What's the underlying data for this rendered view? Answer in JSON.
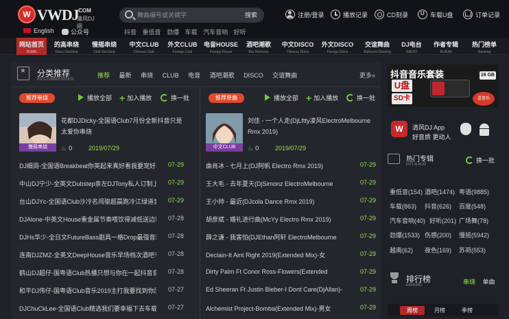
{
  "header": {
    "logo_brand": "VWDJ",
    "logo_com": ".COM",
    "logo_cn": "清风DJ网",
    "search_placeholder": "舞曲编号或关键字",
    "search_button": "搜索",
    "hot_keywords": [
      "抖音",
      "重低音",
      "劲爆",
      "车载",
      "汽车音响",
      "好听"
    ],
    "language": "English",
    "wechat": "公众号",
    "top_links": [
      {
        "label": "注册/登录",
        "icon": "user-icon"
      },
      {
        "label": "播放记录",
        "icon": "clock-icon"
      },
      {
        "label": "CD刻录",
        "icon": "cd-icon"
      },
      {
        "label": "车载U盘",
        "icon": "usb-icon"
      },
      {
        "label": "订单记录",
        "icon": "cart-icon"
      }
    ]
  },
  "nav": [
    {
      "cn": "网站首页",
      "en": "HOME",
      "active": true
    },
    {
      "cn": "的高串烧",
      "en": "Disco NonStop"
    },
    {
      "cn": "慢摇串烧",
      "en": "Club NonStop"
    },
    {
      "cn": "中文CLUB",
      "en": "Chinese Club"
    },
    {
      "cn": "外文CLUB",
      "en": "Foreign Club"
    },
    {
      "cn": "电音HOUSE",
      "en": "Foreign House"
    },
    {
      "cn": "酒吧潮歌",
      "en": "Bar Remixes"
    },
    {
      "cn": "中文DISCO",
      "en": "Chinese Disco"
    },
    {
      "cn": "外文DISCO",
      "en": "Foreign Disco"
    },
    {
      "cn": "交谊舞曲",
      "en": "Ballroom Dancing"
    },
    {
      "cn": "DJ电台",
      "en": "RADIO"
    },
    {
      "cn": "作者专辑",
      "en": "ALBUM"
    },
    {
      "cn": "热门榜单",
      "en": "Ranking"
    }
  ],
  "category": {
    "title": "分类推荐",
    "subtitle": "RECOMMENDED",
    "tabs": [
      "推荐",
      "最新",
      "串烧",
      "CLUB",
      "电音",
      "酒吧潮歌",
      "DISCO",
      "交谊舞曲"
    ],
    "active_tab": 0,
    "more": "更多»"
  },
  "actions": {
    "play_all": "播放全部",
    "add_play": "加入播放",
    "swap": "换一批"
  },
  "left_list": {
    "tag": "推荐串烧",
    "feature": {
      "title": "花都DJDicky-全国语Club7月份全新抖音只是太爱你串烧",
      "badge": "慢摇串烧",
      "plays": "0",
      "date": "2019/07/29"
    },
    "rows": [
      {
        "title": "DJ细周-全国语Breakbeat你英起来真好看我要宠好看",
        "date": "07-29",
        "new": true
      },
      {
        "title": "中山DJ宁少-全英文Dubstep亲左DJTony私人订制上",
        "date": "07-29",
        "new": true
      },
      {
        "title": "台山DJYc-全国语Club沙冷名闯驱超晨跑冷江绿道音乐",
        "date": "07-29",
        "new": true
      },
      {
        "title": "DJAlone-中英文House重金属节奏嗒饮得减低送边场",
        "date": "07-28",
        "new": false
      },
      {
        "title": "DJHs华少-全日文FutureBass剧具一格Drop最强音霸",
        "date": "07-28",
        "new": false
      },
      {
        "title": "连南DJZMZ-全英文DeepHouse音乐早场档次酒吧专",
        "date": "07-28",
        "new": false
      },
      {
        "title": "鹤山DJ超仔-国粤语Club热播只想与你在一起抖音音乐",
        "date": "07-28",
        "new": false
      },
      {
        "title": "和平DJ伟仔-国粤语Club音乐2019主打我要找到你历",
        "date": "07-27",
        "new": false
      },
      {
        "title": "DJChuCkLee-全国语Club精选我们要幸福下去车载串",
        "date": "07-27",
        "new": false
      }
    ]
  },
  "right_list": {
    "tag": "推荐单曲",
    "feature": {
      "title": "刘佳 - 一个人走(DjLftty凌风ElectroMelbourne Rmx 2019)",
      "badge": "中文CLUB",
      "plays": "0",
      "date": "2019/07/29"
    },
    "rows": [
      {
        "title": "曲肖冰 - 七月上(DJ阿帆 Electro Rmx 2019)",
        "date": "07-29"
      },
      {
        "title": "王大毛 - 去年夏天(DjSimonz ElectroMelbourne",
        "date": "07-29"
      },
      {
        "title": "王小帅 - 最近(DJcola Dance Rmx 2019)",
        "date": "07-29"
      },
      {
        "title": "胡彦斌 - 婚礼进行曲(McYy Electro Rmx 2019)",
        "date": "07-29"
      },
      {
        "title": "薛之谦 - 我害怕(DJEthan阿轩 ElectroMelbourne",
        "date": "07-29"
      },
      {
        "title": "Declain-It Aint Right 2019(Extended Mix)-女",
        "date": "07-29"
      },
      {
        "title": "Dirty Palm Ft Conor Ross-Flowers(Extended",
        "date": "07-29"
      },
      {
        "title": "Ed Sheeran Ft Justin Bieber-I Dont Care(DjAllan)-",
        "date": "07-29"
      },
      {
        "title": "Alchemist Project-Bomba(Extended Mix)-男女",
        "date": "07-29"
      }
    ]
  },
  "promo": {
    "line1": "抖音音乐套装",
    "u": "U盘",
    "sd": "SD卡",
    "gb": "16 GB",
    "sticker": "送音乐"
  },
  "app": {
    "name": "清风DJ App",
    "sub1": "好音质",
    "sub2": "更动人"
  },
  "hot_album": {
    "title": "热门专辑",
    "subtitle": "HOT ALBUM",
    "swap": "换一批",
    "tags": [
      [
        "重低音(154)",
        "酒吧(1474)",
        "粤语(9885)"
      ],
      [
        "车载(863)",
        "抖音(626)",
        "百度(548)"
      ],
      [
        "汽车音响(40)",
        "好听(201)",
        "广场舞(78)"
      ],
      [
        "劲爆(1533)",
        "伤感(200)",
        "慢摇(5942)"
      ],
      [
        "越南(62)",
        "夜色(169)",
        "苏荷(553)"
      ]
    ]
  },
  "ranking": {
    "title": "排行榜",
    "subtitle": "RANKING",
    "tabs": [
      "串烧",
      "单曲"
    ],
    "periods": [
      "周榜",
      "月榜",
      "季榜"
    ]
  },
  "colors": {
    "accent": "#9be24a",
    "brand": "#b12a2a",
    "tag": "#e24a2b"
  }
}
